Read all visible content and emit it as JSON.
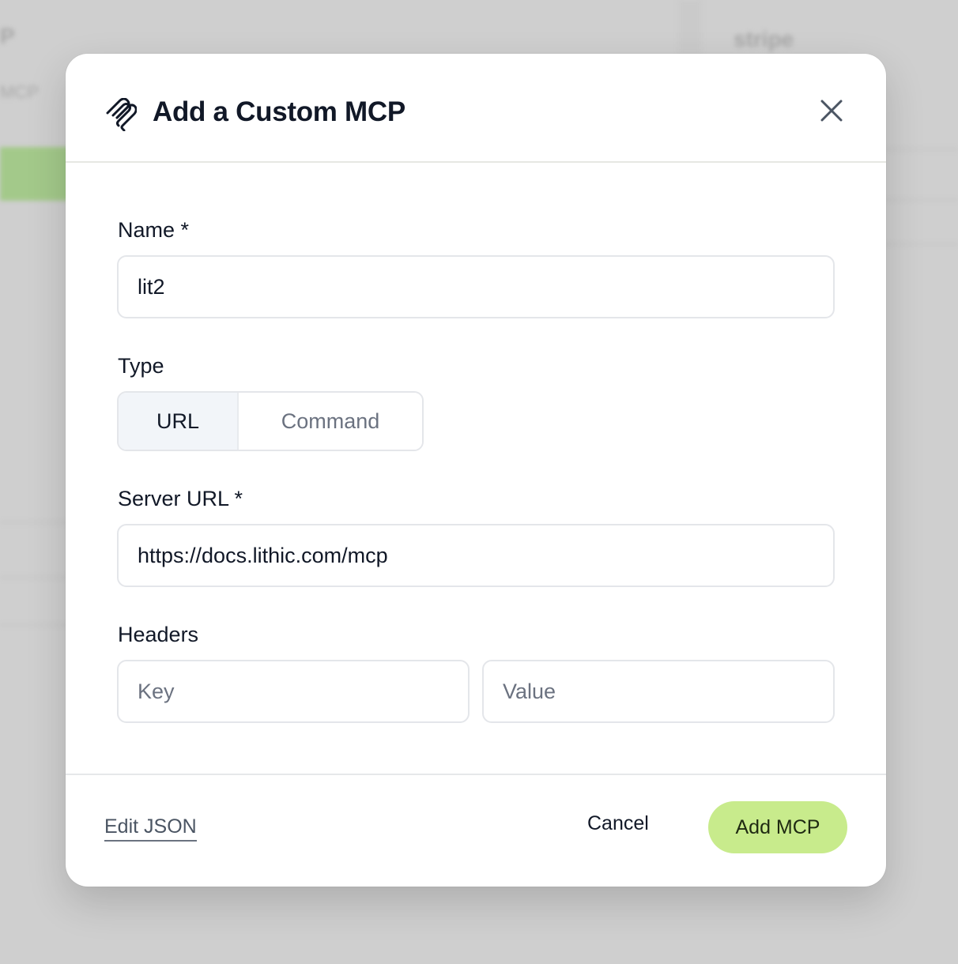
{
  "background": {
    "left_text_1": "P",
    "left_text_2": "MCP",
    "right_text": "stripe"
  },
  "dialog": {
    "title": "Add a Custom MCP",
    "icon": "mcp-logo-icon",
    "close_icon": "close-icon"
  },
  "form": {
    "name": {
      "label": "Name *",
      "value": "lit2"
    },
    "type": {
      "label": "Type",
      "options": [
        "URL",
        "Command"
      ],
      "selected": "URL"
    },
    "server_url": {
      "label": "Server URL *",
      "value": "https://docs.lithic.com/mcp"
    },
    "headers": {
      "label": "Headers",
      "key_placeholder": "Key",
      "value_placeholder": "Value"
    }
  },
  "footer": {
    "edit_json_label": "Edit JSON",
    "cancel_label": "Cancel",
    "add_label": "Add MCP"
  },
  "colors": {
    "accent": "#c8eb8c",
    "selected_segment": "#f2f5f9",
    "border": "#e4e6ea"
  }
}
